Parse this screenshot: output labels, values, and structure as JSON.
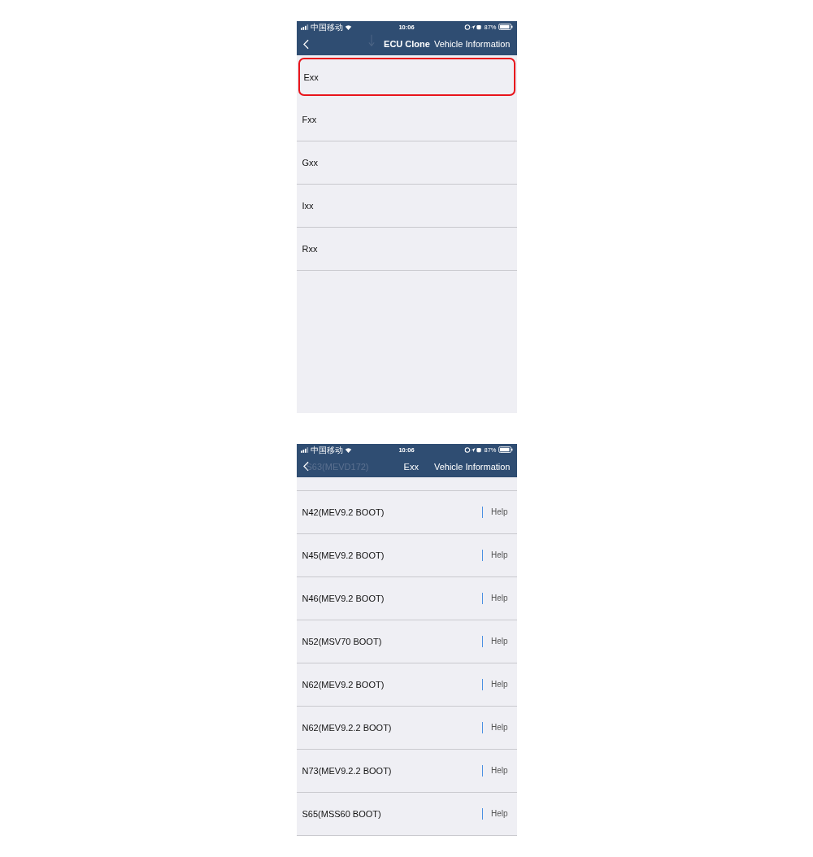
{
  "screens": [
    {
      "status_bar": {
        "carrier": "中国移动",
        "time": "10:06",
        "battery": "87%"
      },
      "nav": {
        "title": "ECU Clone",
        "subtitle": "Vehicle Information"
      },
      "items": [
        {
          "label": "Exx",
          "selected": true
        },
        {
          "label": "Fxx",
          "selected": false
        },
        {
          "label": "Gxx",
          "selected": false
        },
        {
          "label": "Ixx",
          "selected": false
        },
        {
          "label": "Rxx",
          "selected": false
        }
      ]
    },
    {
      "status_bar": {
        "carrier": "中国移动",
        "time": "10:06",
        "battery": "87%"
      },
      "nav": {
        "title": "Exx",
        "subtitle": "Vehicle Information",
        "behind_text": "S63(MEVD172)"
      },
      "items": [
        {
          "label": "N42(MEV9.2 BOOT)",
          "action": "Help"
        },
        {
          "label": "N45(MEV9.2 BOOT)",
          "action": "Help"
        },
        {
          "label": "N46(MEV9.2 BOOT)",
          "action": "Help"
        },
        {
          "label": "N52(MSV70 BOOT)",
          "action": "Help"
        },
        {
          "label": "N62(MEV9.2 BOOT)",
          "action": "Help"
        },
        {
          "label": "N62(MEV9.2.2 BOOT)",
          "action": "Help"
        },
        {
          "label": "N73(MEV9.2.2 BOOT)",
          "action": "Help"
        },
        {
          "label": "S65(MSS60 BOOT)",
          "action": "Help"
        }
      ]
    }
  ]
}
